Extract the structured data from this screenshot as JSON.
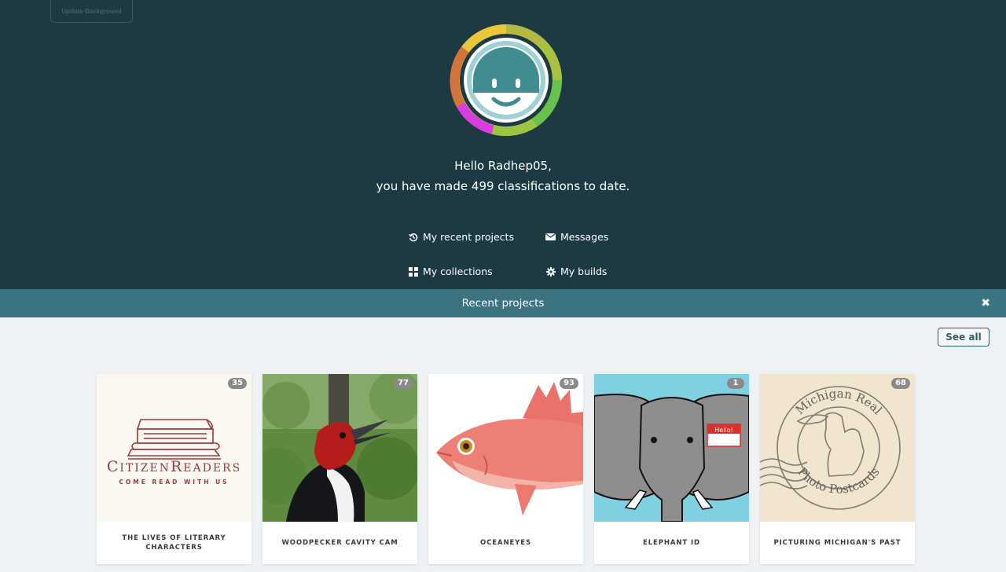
{
  "header": {
    "update_background_label": "Update Background",
    "greeting_line1": "Hello Radhep05,",
    "greeting_line2": "you have made 499 classifications to date."
  },
  "nav": {
    "recent_projects": "My recent projects",
    "messages": "Messages",
    "collections": "My collections",
    "builds": "My builds"
  },
  "recent_bar": {
    "title": "Recent projects",
    "close_icon": "close-icon"
  },
  "see_all_label": "See all",
  "projects": [
    {
      "title": "THE LIVES OF LITERARY CHARACTERS",
      "count": "35"
    },
    {
      "title": "WOODPECKER CAVITY CAM",
      "count": "77"
    },
    {
      "title": "OCEANEYES",
      "count": "93"
    },
    {
      "title": "ELEPHANT ID",
      "count": "1"
    },
    {
      "title": "PICTURING MICHIGAN'S PAST",
      "count": "68"
    }
  ],
  "card_art": {
    "citizen_readers_logo": "CITIZENREADERS",
    "citizen_readers_tagline": "COME READ WITH US",
    "elephant_tag": "Hello!",
    "postmark_top": "Michigan Real",
    "postmark_bottom": "Photo Postcards"
  },
  "colors": {
    "hero_bg": "#1d3a43",
    "bar_bg": "#3b7380",
    "page_bg": "#eff2f5",
    "accent": "#2e5d69"
  }
}
